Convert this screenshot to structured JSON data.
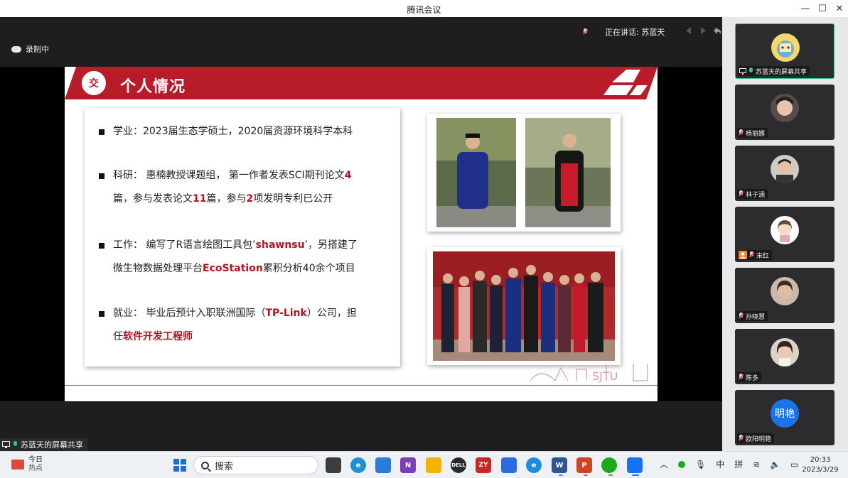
{
  "window": {
    "title": "腾讯会议",
    "controls": [
      "minimize-icon",
      "maximize-icon",
      "close-icon"
    ]
  },
  "recording": {
    "label": "录制中",
    "icon": "cloud-record-icon"
  },
  "speaking": {
    "label": "正在讲话: 苏蓝天",
    "icon": "mic-muted-icon"
  },
  "share_label": "苏蓝天的屏幕共享",
  "slide": {
    "title": "个人情况",
    "bullets": [
      {
        "prefix": "学业：2023届生态学硕士，2020届资源环境科学本科"
      },
      {
        "line1_a": "科研：  惠楠教授课题组，  第一作者发表SCI期刊论文",
        "line1_b": "4",
        "line2_a": "篇，参与发表论文",
        "line2_b": "11",
        "line2_c": "篇，参与",
        "line2_d": "2",
        "line2_e": "项发明专利已公开"
      },
      {
        "line1_a": "工作：  编写了R语言绘图工具包’",
        "line1_b": "shawnsu",
        "line1_c": "’，另搭建了",
        "line2_a": "微生物数据处理平台",
        "line2_b": "EcoStation",
        "line2_c": "累积分析40余个项目"
      },
      {
        "line1_a": "就业：  毕业后预计入职联洲国际（",
        "line1_b": "TP-Link",
        "line1_c": "）公司，担",
        "line2_a": "任",
        "line2_b": "软件开发工程师"
      }
    ],
    "watermark": "SJTU"
  },
  "participants": [
    {
      "name": "苏蓝天的屏幕共享",
      "avatar": "cartoon-avatar",
      "mic": "on",
      "screen_share": true,
      "active": true
    },
    {
      "name": "杨丽娜",
      "avatar": "photo-avatar",
      "mic": "muted"
    },
    {
      "name": "林子涵",
      "avatar": "photo-avatar",
      "mic": "muted"
    },
    {
      "name": "宋红",
      "avatar": "cartoon-avatar",
      "mic": "muted",
      "badge": "person-icon"
    },
    {
      "name": "孙晓慧",
      "avatar": "photo-avatar",
      "mic": "muted"
    },
    {
      "name": "陈多",
      "avatar": "photo-avatar",
      "mic": "muted"
    },
    {
      "name": "欧阳明艳",
      "avatar_text": "明艳",
      "avatar_color": "#1a73e8",
      "mic": "muted"
    }
  ],
  "taskbar": {
    "weather_title": "今日",
    "weather_sub": "热点",
    "search_placeholder": "搜索",
    "tray": {
      "ime_mode": "中",
      "ime_name": "拼"
    },
    "clock_time": "20:33",
    "clock_date": "2023/3/29"
  },
  "colors": {
    "brand_red": "#b81c28",
    "accent_green": "#36c37c",
    "sidebar_bg": "#e8e8ea"
  }
}
